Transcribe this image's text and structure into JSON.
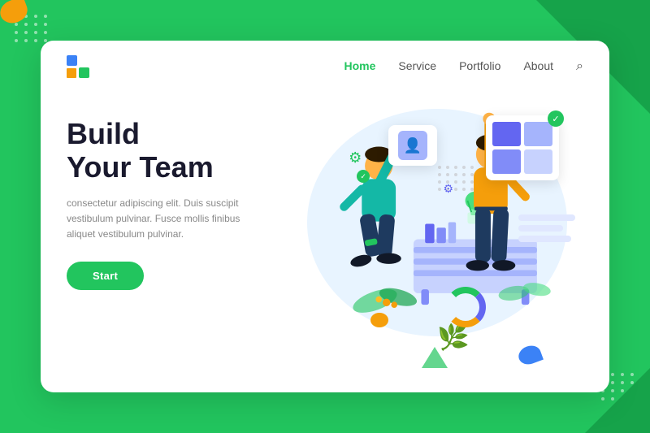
{
  "background": {
    "color": "#22c55e"
  },
  "navbar": {
    "logo_alt": "Logo",
    "links": [
      {
        "label": "Home",
        "active": true
      },
      {
        "label": "Service",
        "active": false
      },
      {
        "label": "Portfolio",
        "active": false
      },
      {
        "label": "About",
        "active": false
      }
    ],
    "search_icon": "🔍"
  },
  "hero": {
    "title_line1": "Build",
    "title_line2": "Your Team",
    "description": "consectetur adipiscing elit. Duis suscipit vestibulum pulvinar. Fusce mollis finibus aliquet vestibulum pulvinar.",
    "cta_label": "Start"
  },
  "dots": {
    "count": 20
  }
}
